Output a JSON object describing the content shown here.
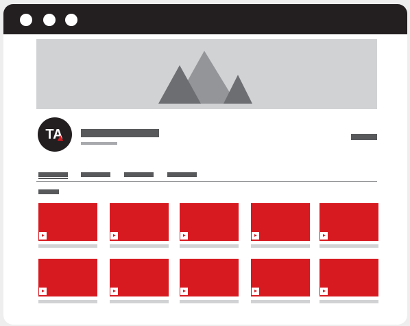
{
  "window": {
    "controls": [
      "window-dot-1",
      "window-dot-2",
      "window-dot-3"
    ]
  },
  "channel": {
    "logo_text": "TA",
    "banner_icon": "mountain-icon"
  },
  "colors": {
    "title_bar": "#231f20",
    "banner": "#d1d2d4",
    "thumbnail": "#d71920",
    "placeholder_dark": "#58595b",
    "placeholder_light": "#d1d2d4"
  },
  "tabs": [
    {
      "name": "tab-1",
      "active": true
    },
    {
      "name": "tab-2",
      "active": false
    },
    {
      "name": "tab-3",
      "active": false
    },
    {
      "name": "tab-4",
      "active": false
    }
  ],
  "videos": {
    "row_1": [
      "video-1",
      "video-2",
      "video-3",
      "video-4",
      "video-5"
    ],
    "row_2": [
      "video-6",
      "video-7",
      "video-8",
      "video-9",
      "video-10"
    ]
  }
}
